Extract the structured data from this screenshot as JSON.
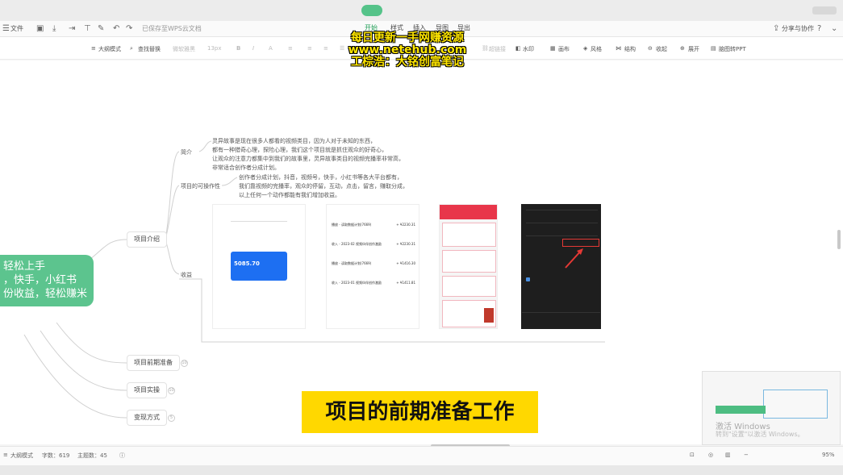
{
  "menubar": {
    "file_menu": "文件",
    "save_status": "已保存至WPS云文档",
    "tabs": [
      "开始",
      "样式",
      "插入",
      "导图",
      "导出"
    ],
    "share": "分享与协作"
  },
  "toolbar": {
    "outline_mode": "大纲模式",
    "find_replace": "查找替换",
    "font": "微软雅黑",
    "font_size": "13px",
    "hyperlink": "超链接",
    "watermark": "水印",
    "canvas": "画布",
    "style": "风格",
    "structure": "结构",
    "collapse": "收起",
    "expand": "展开",
    "to_ppt": "脑图转PPT"
  },
  "overlay": {
    "line1": "每日更新一手网赚资源",
    "line2": "www.netehub.com",
    "line3": "工棕浩：大铭创富笔记"
  },
  "mindmap": {
    "root_lines": [
      "轻松上手",
      "，快手，小红书",
      "份收益，轻松赚米"
    ],
    "branches": [
      {
        "label": "项目介绍",
        "badge": ""
      },
      {
        "label": "项目前期准备",
        "badge": "10"
      },
      {
        "label": "项目实操",
        "badge": "10"
      },
      {
        "label": "变现方式",
        "badge": "5"
      }
    ],
    "subs": {
      "intro": "简介",
      "feasibility": "项目的可操作性",
      "income": "收益"
    },
    "intro_text": [
      "灵异故事是现在很多人都看的视频类目，因为人对于未知的东西，",
      "都有一种猎奇心理，探险心理，我们这个项目就是抓住观众的好奇心，",
      "让观众的注意力都集中到我们的故事里，灵异故事类目的视频完播率非常高，",
      "非常适合创作者分成计划。"
    ],
    "feasibility_text": [
      "创作者分成计划，抖音，视频号，快手，小红书等各大平台都有，",
      "我们靠视频的完播率，观众的停留，互动，点击，留言，赚取分成，",
      "以上任何一个动作都能有我们增加收益。"
    ]
  },
  "thumbs": {
    "balance": "5085.70",
    "records": [
      {
        "title": "播放 - 读取数据计划(7669)",
        "amount": "+ ¥2230.31"
      },
      {
        "title": "收入 - 2023-02 视频伙伴创作激励",
        "amount": "+ ¥2230.31"
      },
      {
        "title": "播放 - 读取数据计划(7669)",
        "amount": "+ ¥1416.30"
      },
      {
        "title": "收入 - 2023-01 视频伙伴创作激励",
        "amount": "+ ¥1411.81"
      }
    ]
  },
  "caption": "项目的前期准备工作",
  "activation": {
    "line1": "激活 Windows",
    "line2": "转到\"设置\"以激活 Windows。"
  },
  "statusbar": {
    "mode": "大纲模式",
    "words": "字数：619",
    "topics": "主题数：45",
    "zoom": "95%"
  },
  "colors": {
    "accent": "#55c389",
    "root": "#5cc48e",
    "caption_bg": "#ffd800",
    "overlay_text": "#ffe600"
  }
}
